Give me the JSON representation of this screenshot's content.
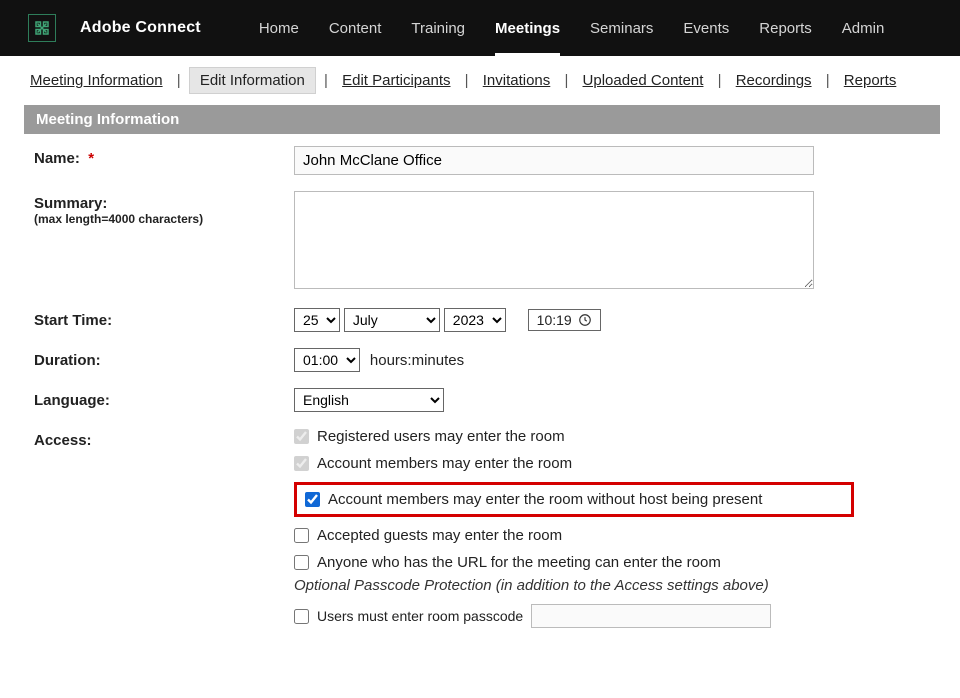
{
  "brand": {
    "name": "Adobe Connect"
  },
  "nav": {
    "items": [
      {
        "label": "Home",
        "active": false
      },
      {
        "label": "Content",
        "active": false
      },
      {
        "label": "Training",
        "active": false
      },
      {
        "label": "Meetings",
        "active": true
      },
      {
        "label": "Seminars",
        "active": false
      },
      {
        "label": "Events",
        "active": false
      },
      {
        "label": "Reports",
        "active": false
      },
      {
        "label": "Admin",
        "active": false
      }
    ]
  },
  "subtabs": {
    "items": [
      {
        "label": "Meeting Information",
        "selected": false
      },
      {
        "label": "Edit Information",
        "selected": true
      },
      {
        "label": "Edit Participants",
        "selected": false
      },
      {
        "label": "Invitations",
        "selected": false
      },
      {
        "label": "Uploaded Content",
        "selected": false
      },
      {
        "label": "Recordings",
        "selected": false
      },
      {
        "label": "Reports",
        "selected": false
      }
    ]
  },
  "section": {
    "title": "Meeting Information"
  },
  "form": {
    "name": {
      "label": "Name:",
      "required": "*",
      "value": "John McClane Office"
    },
    "summary": {
      "label": "Summary:",
      "sub": "(max length=4000 characters)",
      "value": ""
    },
    "start": {
      "label": "Start Time:",
      "day": "25",
      "month": "July",
      "year": "2023",
      "time": "10:19"
    },
    "duration": {
      "label": "Duration:",
      "value": "01:00",
      "suffix": "hours:minutes"
    },
    "language": {
      "label": "Language:",
      "value": "English"
    },
    "access": {
      "label": "Access:",
      "options": [
        {
          "label": "Registered users may enter the room",
          "checked": true,
          "locked": true,
          "highlight": false
        },
        {
          "label": "Account members may enter the room",
          "checked": true,
          "locked": true,
          "highlight": false
        },
        {
          "label": "Account members may enter the room without host being present",
          "checked": true,
          "locked": false,
          "highlight": true
        },
        {
          "label": "Accepted guests may enter the room",
          "checked": false,
          "locked": false,
          "highlight": false
        },
        {
          "label": "Anyone who has the URL for the meeting can enter the room",
          "checked": false,
          "locked": false,
          "highlight": false
        }
      ],
      "passcode_note": "Optional Passcode Protection (in addition to the Access settings above)",
      "passcode": {
        "label": "Users must enter room passcode",
        "checked": false,
        "value": ""
      }
    }
  }
}
